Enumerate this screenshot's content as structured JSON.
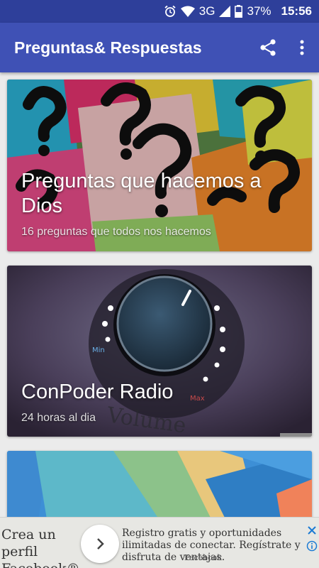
{
  "status_bar": {
    "network": "3G",
    "battery": "37%",
    "time": "15:56"
  },
  "app_bar": {
    "title": "Preguntas& Respuestas",
    "share_icon": "share-icon",
    "menu_icon": "overflow-menu-icon"
  },
  "cards": [
    {
      "title": "Preguntas que hacemos a Dios",
      "subtitle": "16 preguntas que todos nos hacemos"
    },
    {
      "title": "ConPoder Radio",
      "subtitle": "24 horas al dia"
    }
  ],
  "ad": {
    "left_text": "Crea un perfil Facebook®",
    "body_text": "Registro gratis y oportunidades ilimitadas de conectar. Regístrate y disfruta de ventajas.",
    "brand": "Facebook"
  },
  "colors": {
    "status_bar": "#2e3f9a",
    "app_bar": "#3f51b5",
    "background": "#ebebeb"
  }
}
